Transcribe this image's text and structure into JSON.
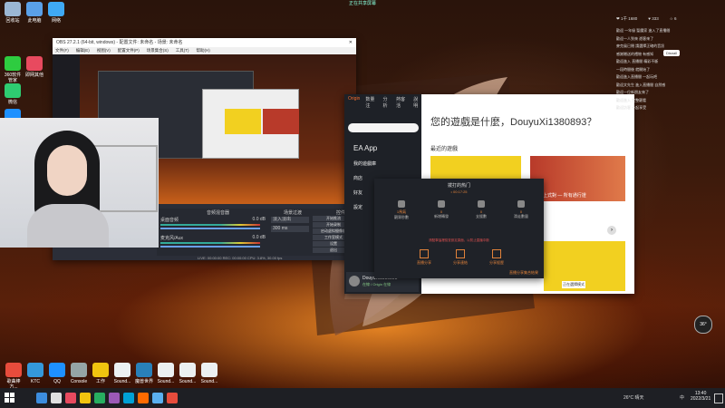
{
  "top_center": {
    "label": "正在共享屏幕"
  },
  "desktop_icons": [
    {
      "label": "回收站",
      "color": "#9bb7d4"
    },
    {
      "label": "此电脑",
      "color": "#5aa0e8"
    },
    {
      "label": "网络",
      "color": "#3fa9f5"
    },
    {
      "label": "360软件管家",
      "color": "#2ecc40"
    },
    {
      "label": "即网其他",
      "color": "#e84a5f"
    },
    {
      "label": "微信",
      "color": "#2ecc71"
    },
    {
      "label": "QQ",
      "color": "#1e90ff"
    }
  ],
  "obs": {
    "title": "OBS 27.2.1 (64-bit, windows) - 配置文件: 未命名 - 场景: 未命名",
    "menu": [
      "文件(F)",
      "编辑(E)",
      "视图(V)",
      "配置文件(P)",
      "场景集合(S)",
      "工具(T)",
      "帮助(H)"
    ],
    "mixer_header": "音频混音器",
    "transition_header": "场景过渡",
    "controls_header": "控件",
    "mixer_rows": [
      {
        "label": "桌面音频",
        "value": "0.0 dB"
      },
      {
        "label": "麦克风/Aux",
        "value": "0.0 dB"
      }
    ],
    "transition_type": "淡入淡出",
    "duration": "300 ms",
    "control_buttons": [
      "开始推流",
      "开始录制",
      "启动虚拟摄像机",
      "工作室模式",
      "设置",
      "退出"
    ],
    "status": "LIVE: 00:00:00   REC: 00:00:00   CPU: 3.8%, 30.00 fps"
  },
  "ea": {
    "sidebar_brand": "Origin",
    "menu": [
      "数量注",
      "分析",
      "熱客活",
      "說明"
    ],
    "sidebar_items": [
      "EA App",
      "我的遊戲庫",
      "商店",
      "好友",
      "設定"
    ],
    "headline": "您的遊戲是什麼，DouyuXi1380893？",
    "recent": "最近的遊戲",
    "game_caption": "地鐵上式對 — 所有通行證",
    "game_badge": "正在選擇模式",
    "user": {
      "name": "DouyuXi1380893",
      "status": "在線 / Origin 在線"
    }
  },
  "popup": {
    "title": "拨打的热门",
    "subtitle": "• 00:17:25",
    "stats": [
      {
        "label": "觀眾秒數",
        "value": "1馬氣"
      },
      {
        "label": "新增轉發",
        "value": "0"
      },
      {
        "label": "支援數",
        "value": "0"
      },
      {
        "label": "滑走數量",
        "value": "0"
      }
    ],
    "notice": "請點擊這裡檢查設定頁面，以防止直播中斷",
    "actions": [
      "直播分享",
      "分享連結",
      "分享經歷"
    ],
    "footer": "直播分享集合結果"
  },
  "chat": {
    "stats": [
      "❤ 1千 1680",
      "♥ 333",
      "☆ 6"
    ],
    "messages": [
      "歡迎 一年級 聖魔家 進入了直播間",
      "歡迎一人到來 遊客來了",
      "麥克風已閉 請選擇正確的音訊",
      "感謝贈送的禮物 有感知",
      "歡迎進入 直播間 精彩不斷",
      "一段時間後 就開始了",
      "歡迎進入直播間 一起玩吧",
      "歡迎文先生 進入直播間 自然感",
      "歡迎一位新朋友來了",
      "歡迎進入 完整觀看",
      "歡迎訪客 一起享受"
    ],
    "online_badge": "Disnall"
  },
  "weather_badge": {
    "value": "36°",
    "label": "晴"
  },
  "taskbar": {
    "icons_colors": [
      "#3c8dde",
      "#e0e0e0",
      "#e84a5f",
      "#f1c40f",
      "#27ae60",
      "#9b59b6",
      "#00a1d6",
      "#ff6b00",
      "#5ab0f0",
      "#e74c3c"
    ],
    "weather": "26°C 晴天",
    "time": "13:40",
    "date": "2022/3/21",
    "lang": "中"
  },
  "bottom_icons": [
    {
      "label": "歌曲棒方...",
      "color": "#e74c3c"
    },
    {
      "label": "KTC",
      "color": "#3498db"
    },
    {
      "label": "QQ",
      "color": "#1e90ff"
    },
    {
      "label": "Console",
      "color": "#95a5a6"
    },
    {
      "label": "工作",
      "color": "#f1c40f"
    },
    {
      "label": "Sound...",
      "color": "#ecf0f1"
    },
    {
      "label": "魔兽世界",
      "color": "#2980b9"
    },
    {
      "label": "Sound...",
      "color": "#ecf0f1"
    },
    {
      "label": "Sound...",
      "color": "#ecf0f1"
    },
    {
      "label": "Sound...",
      "color": "#ecf0f1"
    }
  ]
}
